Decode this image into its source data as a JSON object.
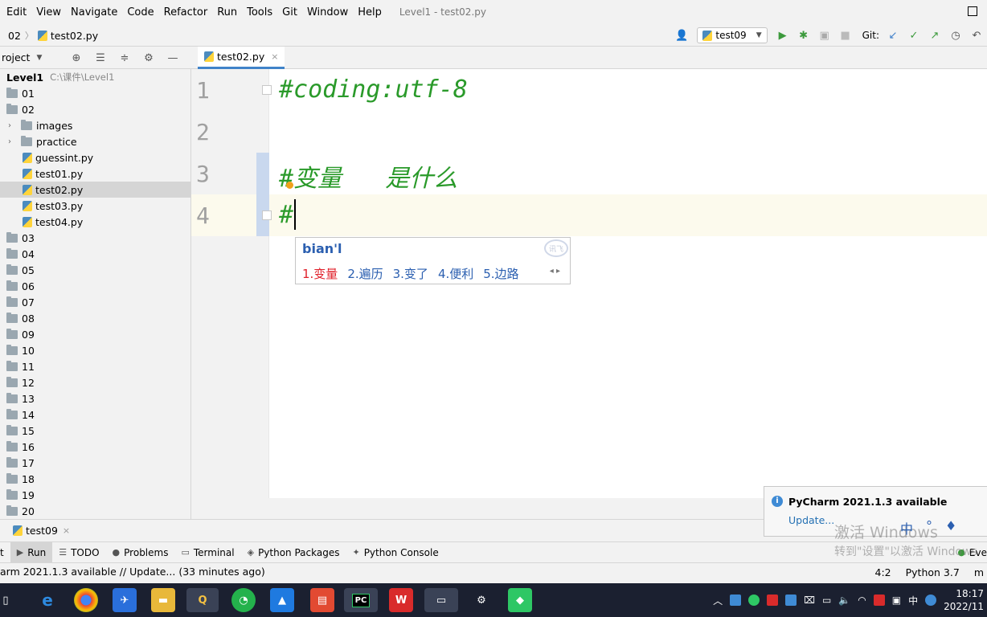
{
  "menubar": {
    "items": [
      "Edit",
      "View",
      "Navigate",
      "Code",
      "Refactor",
      "Run",
      "Tools",
      "Git",
      "Window",
      "Help"
    ],
    "window_title": "Level1 - test02.py"
  },
  "navbar": {
    "crumb_folder": "02",
    "crumb_file": "test02.py",
    "run_config": "test09",
    "git_label": "Git:"
  },
  "project": {
    "title": "roject",
    "root_name": "Level1",
    "root_path": "C:\\课件\\Level1",
    "items": [
      "01",
      "02",
      "images",
      "practice",
      "guessint.py",
      "test01.py",
      "test02.py",
      "test03.py",
      "test04.py",
      "03",
      "04",
      "05",
      "06",
      "07",
      "08",
      "09",
      "10",
      "11",
      "12",
      "13",
      "14",
      "15",
      "16",
      "17",
      "18",
      "19",
      "20"
    ]
  },
  "editor": {
    "tab_label": "test02.py",
    "tab_close": "×",
    "line_numbers": [
      "1",
      "2",
      "3",
      "4"
    ],
    "lines": [
      "#coding:utf-8",
      "",
      "#变量   是什么",
      "#"
    ]
  },
  "ime": {
    "input": "bian'l",
    "candidates": [
      "1.变量",
      "2.遍历",
      "3.变了",
      "4.便利",
      "5.边路"
    ],
    "nav": "◂  ▸",
    "logo": "讯飞"
  },
  "run_panel": {
    "tab_label": "test09",
    "tab_close": "×"
  },
  "tool_windows": {
    "items": [
      "t",
      "Run",
      "TODO",
      "Problems",
      "Terminal",
      "Python Packages",
      "Python Console"
    ],
    "event_log": "Eve"
  },
  "status": {
    "message": "arm 2021.1.3 available // Update... (33 minutes ago)",
    "position": "4:2",
    "interpreter": "Python 3.7",
    "trail": "m"
  },
  "notification": {
    "title": "PyCharm 2021.1.3 available",
    "link": "Update..."
  },
  "watermark": {
    "line1": "激活 Windows",
    "line2": "转到\"设置\"以激活 Windows"
  },
  "ime_toolbar": [
    "中",
    "°",
    "♦"
  ],
  "taskbar": {
    "tray_lang": "中",
    "time": "18:17",
    "date": "2022/11"
  },
  "colors": {
    "comment_green": "#2a9a2a",
    "accent_blue": "#4083c9",
    "link_blue": "#2470b3",
    "taskbar_bg": "#1b2030"
  }
}
